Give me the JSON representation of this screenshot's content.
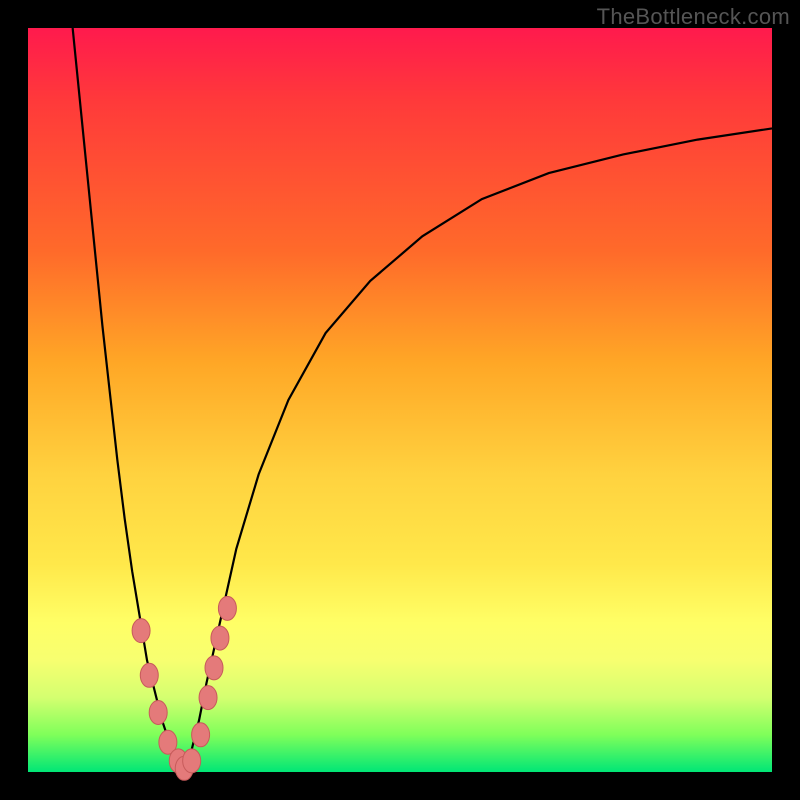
{
  "watermark": "TheBottleneck.com",
  "colors": {
    "frame": "#000000",
    "gradient_top": "#ff1a4d",
    "gradient_mid": "#ffd23f",
    "gradient_bottom": "#00e676",
    "curve": "#000000",
    "bead_fill": "#e47a7a",
    "bead_stroke": "#c75b5b"
  },
  "chart_data": {
    "type": "line",
    "title": "",
    "xlabel": "",
    "ylabel": "",
    "xlim": [
      0,
      100
    ],
    "ylim": [
      0,
      100
    ],
    "series": [
      {
        "name": "left-branch",
        "x": [
          6,
          8,
          10,
          12,
          13,
          14,
          15,
          16,
          17,
          18,
          19,
          20,
          21
        ],
        "y": [
          100,
          80,
          60,
          42,
          34,
          27,
          21,
          15,
          11,
          7,
          4,
          2,
          0
        ]
      },
      {
        "name": "right-branch",
        "x": [
          21,
          22,
          23,
          24,
          26,
          28,
          31,
          35,
          40,
          46,
          53,
          61,
          70,
          80,
          90,
          100
        ],
        "y": [
          0,
          3,
          7,
          12,
          21,
          30,
          40,
          50,
          59,
          66,
          72,
          77,
          80.5,
          83,
          85,
          86.5
        ]
      }
    ],
    "markers": {
      "name": "beads",
      "points": [
        {
          "x": 15.2,
          "y": 19
        },
        {
          "x": 16.3,
          "y": 13
        },
        {
          "x": 17.5,
          "y": 8
        },
        {
          "x": 18.8,
          "y": 4
        },
        {
          "x": 20.2,
          "y": 1.5
        },
        {
          "x": 21.0,
          "y": 0.5
        },
        {
          "x": 22.0,
          "y": 1.5
        },
        {
          "x": 23.2,
          "y": 5
        },
        {
          "x": 24.2,
          "y": 10
        },
        {
          "x": 25.0,
          "y": 14
        },
        {
          "x": 25.8,
          "y": 18
        },
        {
          "x": 26.8,
          "y": 22
        }
      ]
    }
  }
}
